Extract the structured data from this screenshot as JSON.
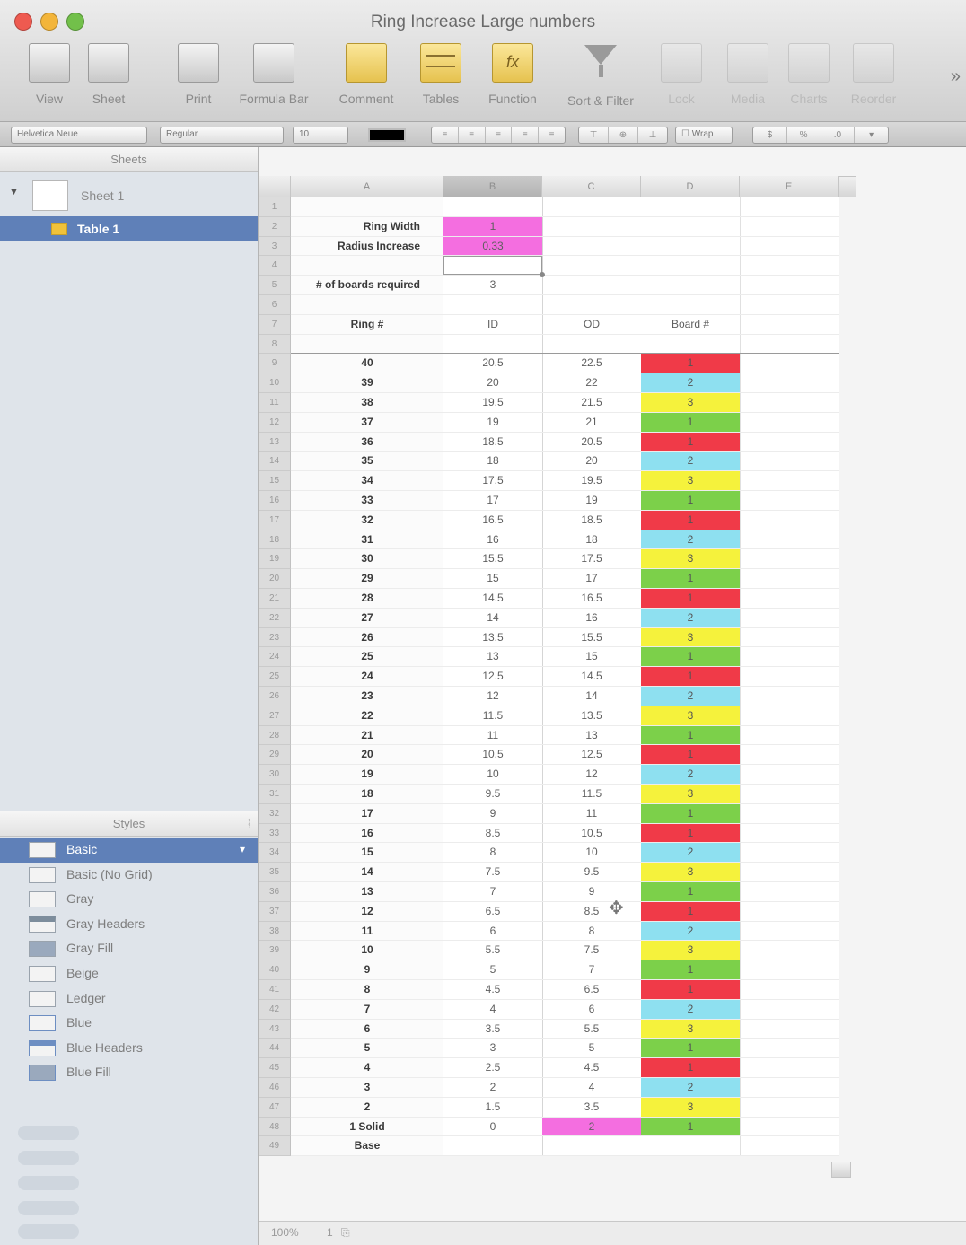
{
  "window": {
    "title": "Ring Increase Large numbers"
  },
  "toolbar": {
    "items": [
      {
        "label": "View",
        "icon": "view-icon"
      },
      {
        "label": "Sheet",
        "icon": "sheet-icon"
      },
      {
        "label": "Print",
        "icon": "print-icon"
      },
      {
        "label": "Formula Bar",
        "icon": "formula-bar-icon"
      },
      {
        "label": "Comment",
        "icon": "comment-icon"
      },
      {
        "label": "Tables",
        "icon": "tables-icon"
      },
      {
        "label": "Function",
        "icon": "function-icon"
      },
      {
        "label": "Sort & Filter",
        "icon": "sort-filter-icon"
      },
      {
        "label": "Lock",
        "icon": "lock-icon"
      },
      {
        "label": "Media",
        "icon": "media-icon"
      },
      {
        "label": "Charts",
        "icon": "charts-icon"
      },
      {
        "label": "Reorder",
        "icon": "reorder-icon"
      }
    ],
    "overflow": "»"
  },
  "format_bar": {
    "style": "Helvetica Neue",
    "typeface": "Regular",
    "size": "10",
    "wrap": "Wrap"
  },
  "sidebar": {
    "sheets_title": "Sheets",
    "sheet_name": "Sheet 1",
    "table_name": "Table 1",
    "styles_title": "Styles",
    "styles": [
      "Basic",
      "Basic (No Grid)",
      "Gray",
      "Gray Headers",
      "Gray Fill",
      "Beige",
      "Ledger",
      "Blue",
      "Blue Headers",
      "Blue Fill"
    ]
  },
  "table": {
    "columns": [
      "A",
      "B",
      "C",
      "D",
      "E"
    ],
    "params": {
      "ring_width_label": "Ring Width",
      "ring_width_value": "1",
      "radius_increase_label": "Radius Increase",
      "radius_increase_value": "0.33",
      "boards_label": "# of boards required",
      "boards_value": "3"
    },
    "headers": {
      "ring": "Ring #",
      "id": "ID",
      "od": "OD",
      "board": "Board #"
    },
    "rows": [
      {
        "ring": "40",
        "id": "20.5",
        "od": "22.5",
        "board": "1"
      },
      {
        "ring": "39",
        "id": "20",
        "od": "22",
        "board": "2"
      },
      {
        "ring": "38",
        "id": "19.5",
        "od": "21.5",
        "board": "3"
      },
      {
        "ring": "37",
        "id": "19",
        "od": "21",
        "board": "1"
      },
      {
        "ring": "36",
        "id": "18.5",
        "od": "20.5",
        "board": "1"
      },
      {
        "ring": "35",
        "id": "18",
        "od": "20",
        "board": "2"
      },
      {
        "ring": "34",
        "id": "17.5",
        "od": "19.5",
        "board": "3"
      },
      {
        "ring": "33",
        "id": "17",
        "od": "19",
        "board": "1"
      },
      {
        "ring": "32",
        "id": "16.5",
        "od": "18.5",
        "board": "1"
      },
      {
        "ring": "31",
        "id": "16",
        "od": "18",
        "board": "2"
      },
      {
        "ring": "30",
        "id": "15.5",
        "od": "17.5",
        "board": "3"
      },
      {
        "ring": "29",
        "id": "15",
        "od": "17",
        "board": "1"
      },
      {
        "ring": "28",
        "id": "14.5",
        "od": "16.5",
        "board": "1"
      },
      {
        "ring": "27",
        "id": "14",
        "od": "16",
        "board": "2"
      },
      {
        "ring": "26",
        "id": "13.5",
        "od": "15.5",
        "board": "3"
      },
      {
        "ring": "25",
        "id": "13",
        "od": "15",
        "board": "1"
      },
      {
        "ring": "24",
        "id": "12.5",
        "od": "14.5",
        "board": "1"
      },
      {
        "ring": "23",
        "id": "12",
        "od": "14",
        "board": "2"
      },
      {
        "ring": "22",
        "id": "11.5",
        "od": "13.5",
        "board": "3"
      },
      {
        "ring": "21",
        "id": "11",
        "od": "13",
        "board": "1"
      },
      {
        "ring": "20",
        "id": "10.5",
        "od": "12.5",
        "board": "1"
      },
      {
        "ring": "19",
        "id": "10",
        "od": "12",
        "board": "2"
      },
      {
        "ring": "18",
        "id": "9.5",
        "od": "11.5",
        "board": "3"
      },
      {
        "ring": "17",
        "id": "9",
        "od": "11",
        "board": "1"
      },
      {
        "ring": "16",
        "id": "8.5",
        "od": "10.5",
        "board": "1"
      },
      {
        "ring": "15",
        "id": "8",
        "od": "10",
        "board": "2"
      },
      {
        "ring": "14",
        "id": "7.5",
        "od": "9.5",
        "board": "3"
      },
      {
        "ring": "13",
        "id": "7",
        "od": "9",
        "board": "1"
      },
      {
        "ring": "12",
        "id": "6.5",
        "od": "8.5",
        "board": "1"
      },
      {
        "ring": "11",
        "id": "6",
        "od": "8",
        "board": "2"
      },
      {
        "ring": "10",
        "id": "5.5",
        "od": "7.5",
        "board": "3"
      },
      {
        "ring": "9",
        "id": "5",
        "od": "7",
        "board": "1"
      },
      {
        "ring": "8",
        "id": "4.5",
        "od": "6.5",
        "board": "1"
      },
      {
        "ring": "7",
        "id": "4",
        "od": "6",
        "board": "2"
      },
      {
        "ring": "6",
        "id": "3.5",
        "od": "5.5",
        "board": "3"
      },
      {
        "ring": "5",
        "id": "3",
        "od": "5",
        "board": "1"
      },
      {
        "ring": "4",
        "id": "2.5",
        "od": "4.5",
        "board": "1"
      },
      {
        "ring": "3",
        "id": "2",
        "od": "4",
        "board": "2"
      },
      {
        "ring": "2",
        "id": "1.5",
        "od": "3.5",
        "board": "3"
      },
      {
        "ring": "1 Solid",
        "id": "0",
        "od": "2",
        "board": "1"
      },
      {
        "ring": "Base",
        "id": "",
        "od": "",
        "board": ""
      }
    ]
  },
  "colors": {
    "pink": "#f46ee0",
    "red": "#f03a48",
    "blue": "#8ee0f0",
    "yellow": "#f5f23c",
    "green": "#7cd04a",
    "selection": "#5f80b8"
  },
  "board_cycle": [
    "red",
    "blue",
    "yellow",
    "green"
  ],
  "statusbar": {
    "zoom": "100%",
    "pages": "1"
  }
}
